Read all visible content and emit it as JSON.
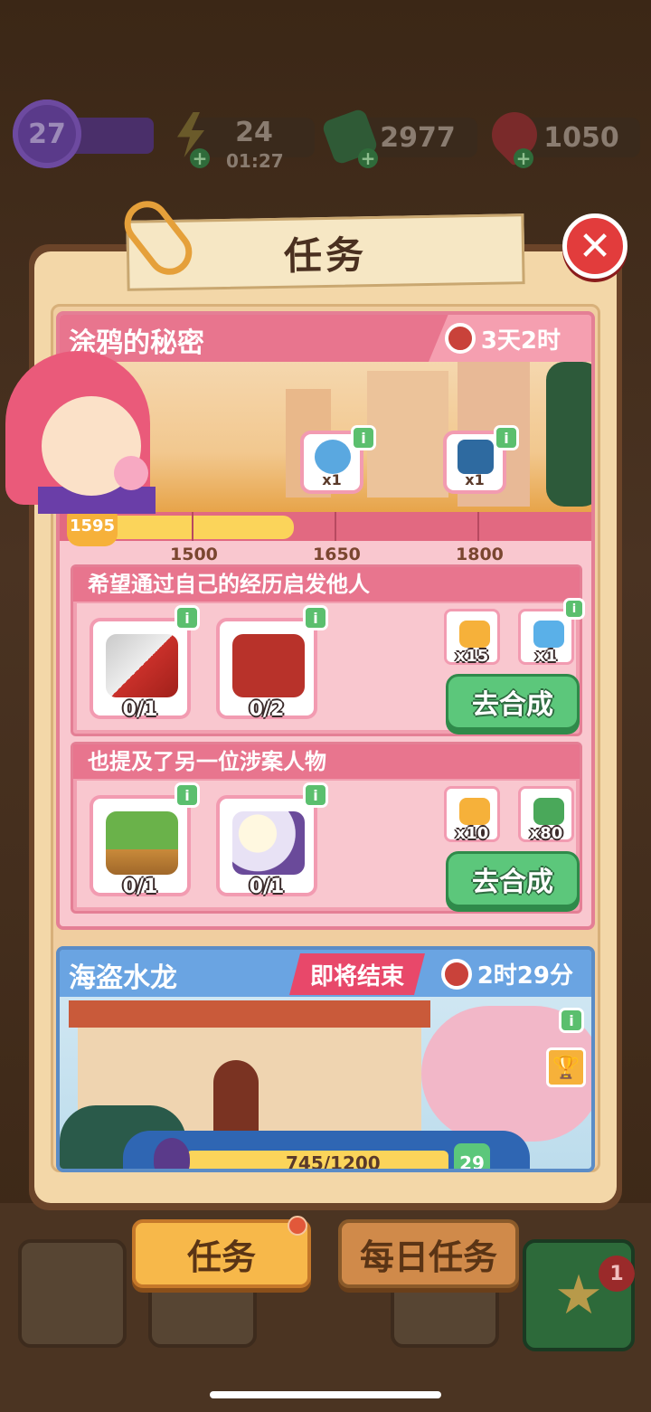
{
  "status_bar": {
    "level": "27",
    "energy": "24",
    "energy_timer": "01:27",
    "cash": "2977",
    "gems": "1050",
    "plus": "+"
  },
  "dialog": {
    "title": "任务",
    "close_symbol": "✕"
  },
  "quest_main": {
    "title": "涂鸦的秘密",
    "timer": "3天2时",
    "current_points": "1595",
    "progress_fraction": 0.44,
    "milestones": [
      "1500",
      "1650",
      "1800"
    ],
    "rewards": [
      {
        "icon": "balloon-pack-icon",
        "count": "x1"
      },
      {
        "icon": "treasure-chest-icon",
        "count": "x1"
      }
    ],
    "tasks": [
      {
        "title": "希望通过自己的经历启发他人",
        "items": [
          {
            "icon": "saw-icon",
            "progress": "0/1"
          },
          {
            "icon": "gloves-icon",
            "progress": "0/2"
          }
        ],
        "rewards": [
          {
            "icon": "star-points-icon",
            "count": "x15"
          },
          {
            "icon": "energy-jar-icon",
            "count": "x1"
          }
        ],
        "button": "去合成"
      },
      {
        "title": "也提及了另一位涉案人物",
        "items": [
          {
            "icon": "potted-plant-icon",
            "progress": "0/1"
          },
          {
            "icon": "flower-bunch-icon",
            "progress": "0/1"
          }
        ],
        "rewards": [
          {
            "icon": "star-points-icon",
            "count": "x10"
          },
          {
            "icon": "cash-icon",
            "count": "x80"
          }
        ],
        "button": "去合成"
      }
    ]
  },
  "quest_second": {
    "title": "海盗水龙",
    "tag": "即将结束",
    "timer": "2时29分",
    "progress": "745/1200",
    "level": "29"
  },
  "info_symbol": "i",
  "bottom_tabs": {
    "active": "任务",
    "inactive": "每日任务",
    "star_notification": "1"
  },
  "colors": {
    "quest_pink": "#e8758e",
    "quest_blue": "#6aa4e2",
    "go_button": "#5cc77b",
    "close_button": "#e23c3c",
    "progress_yellow": "#fbd45a"
  }
}
